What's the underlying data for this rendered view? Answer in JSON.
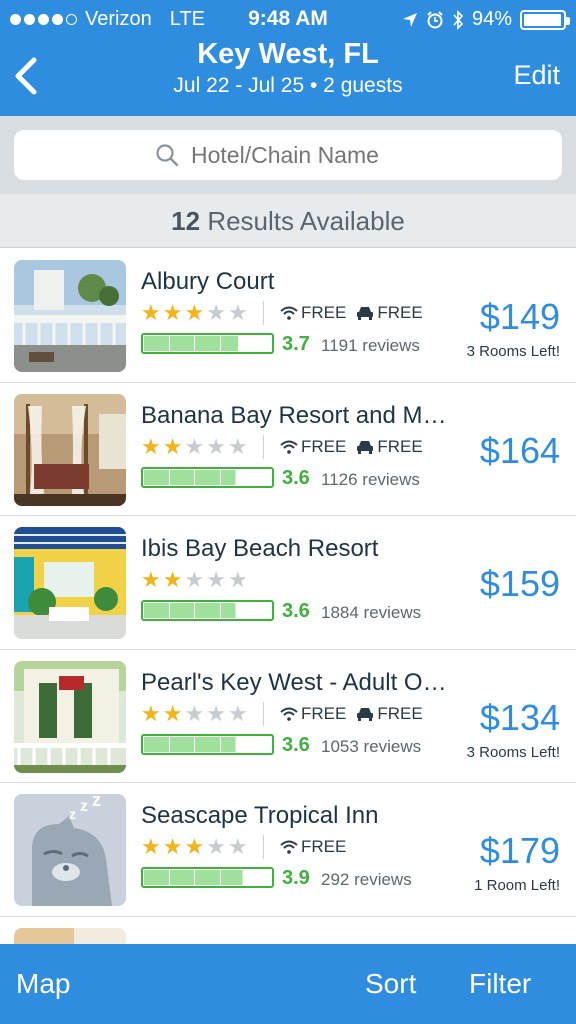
{
  "status_bar": {
    "carrier": "Verizon",
    "network": "LTE",
    "time": "9:48 AM",
    "battery": "94%"
  },
  "nav": {
    "back_icon": "chevron-left-icon",
    "title": "Key West, FL",
    "subtitle": "Jul 22 - Jul 25 • 2 guests",
    "edit_label": "Edit"
  },
  "search": {
    "placeholder": "Hotel/Chain Name",
    "value": ""
  },
  "results": {
    "count": "12",
    "label": "Results Available"
  },
  "hotels": [
    {
      "name": "Albury Court",
      "stars": 3,
      "amenities": [
        "FREE",
        "FREE"
      ],
      "amenity_icons": [
        "wifi-icon",
        "car-icon"
      ],
      "score": "3.7",
      "score_value": 3.7,
      "reviews": "1191 reviews",
      "price": "$149",
      "note": "3 Rooms Left!"
    },
    {
      "name": "Banana Bay Resort and M…",
      "stars": 2,
      "amenities": [
        "FREE",
        "FREE"
      ],
      "amenity_icons": [
        "wifi-icon",
        "car-icon"
      ],
      "score": "3.6",
      "score_value": 3.6,
      "reviews": "1126 reviews",
      "price": "$164",
      "note": ""
    },
    {
      "name": "Ibis Bay Beach Resort",
      "stars": 2,
      "amenities": [],
      "amenity_icons": [],
      "score": "3.6",
      "score_value": 3.6,
      "reviews": "1884 reviews",
      "price": "$159",
      "note": ""
    },
    {
      "name": "Pearl's Key West - Adult O…",
      "stars": 2,
      "amenities": [
        "FREE",
        "FREE"
      ],
      "amenity_icons": [
        "wifi-icon",
        "car-icon"
      ],
      "score": "3.6",
      "score_value": 3.6,
      "reviews": "1053 reviews",
      "price": "$134",
      "note": "3 Rooms Left!"
    },
    {
      "name": "Seascape Tropical Inn",
      "stars": 3,
      "amenities": [
        "FREE"
      ],
      "amenity_icons": [
        "wifi-icon"
      ],
      "score": "3.9",
      "score_value": 3.9,
      "reviews": "292 reviews",
      "price": "$179",
      "note": "1 Room Left!"
    }
  ],
  "tabbar": {
    "map_label": "Map",
    "sort_label": "Sort",
    "filter_label": "Filter"
  },
  "colors": {
    "brand_blue": "#2f8de0",
    "score_green": "#3fb13c",
    "star_gold": "#f2b418"
  }
}
